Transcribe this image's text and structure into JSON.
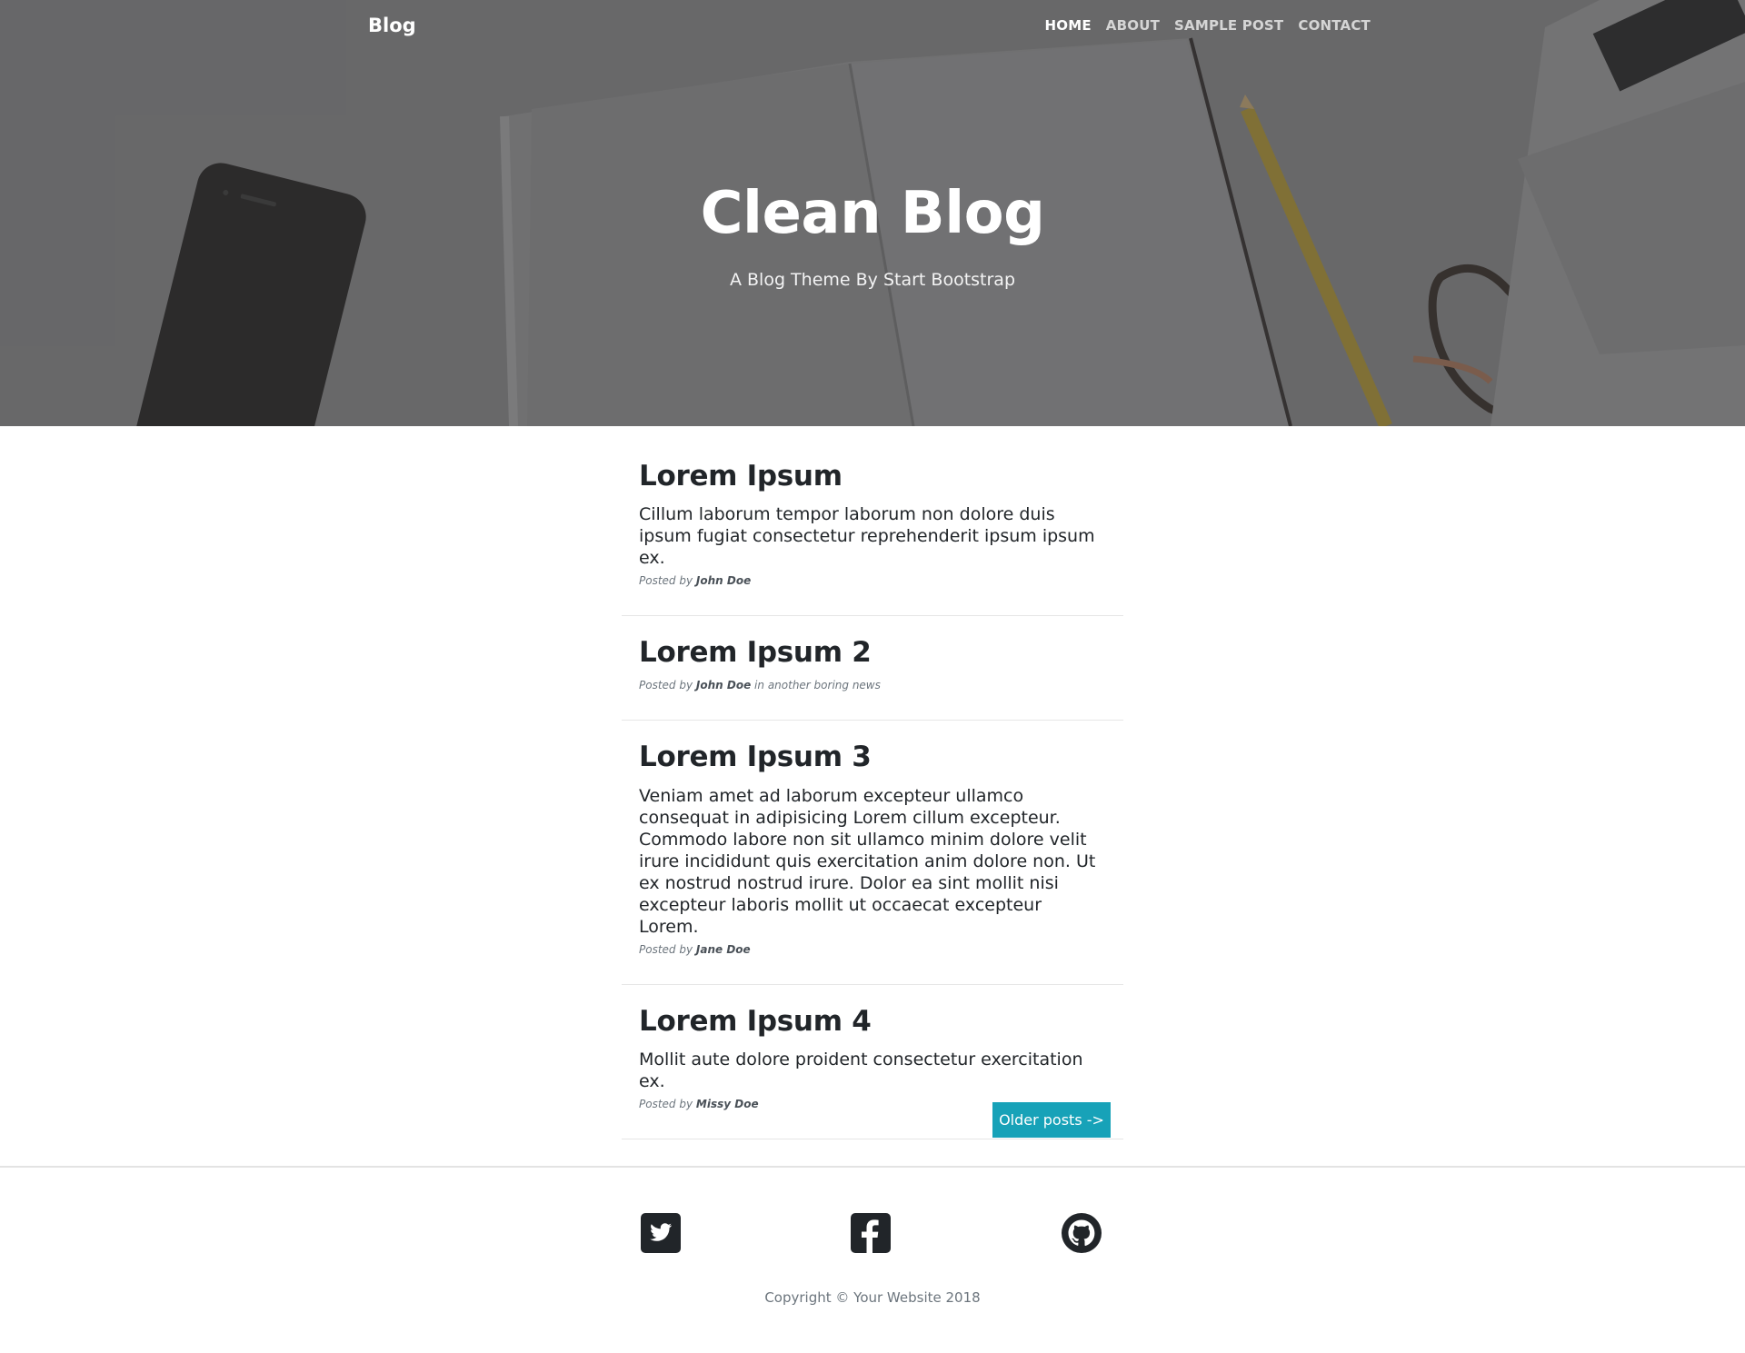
{
  "nav": {
    "brand": "Blog",
    "links": [
      "HOME",
      "ABOUT",
      "SAMPLE POST",
      "CONTACT"
    ],
    "active_index": 0
  },
  "hero": {
    "title": "Clean Blog",
    "subtitle": "A Blog Theme By Start Bootstrap"
  },
  "posts": [
    {
      "title": "Lorem Ipsum",
      "excerpt": "Cillum laborum tempor laborum non dolore duis ipsum fugiat consectetur reprehenderit ipsum ipsum ex.",
      "posted_by": "Posted by",
      "author": "John Doe",
      "category_prefix": "",
      "category": ""
    },
    {
      "title": "Lorem Ipsum 2",
      "excerpt": "",
      "posted_by": "Posted by",
      "author": "John Doe",
      "category_prefix": " in ",
      "category": "another boring news"
    },
    {
      "title": "Lorem Ipsum 3",
      "excerpt": "Veniam amet ad laborum excepteur ullamco consequat in adipisicing Lorem cillum excepteur. Commodo labore non sit ullamco minim dolore velit irure incididunt quis exercitation anim dolore non. Ut ex nostrud nostrud irure. Dolor ea sint mollit nisi excepteur laboris mollit ut occaecat excepteur Lorem.",
      "posted_by": "Posted by",
      "author": "Jane Doe",
      "category_prefix": "",
      "category": ""
    },
    {
      "title": "Lorem Ipsum 4",
      "excerpt": "Mollit aute dolore proident consectetur exercitation ex.",
      "posted_by": "Posted by",
      "author": "Missy Doe",
      "category_prefix": "",
      "category": ""
    }
  ],
  "pager": {
    "older_label": "Older posts ->"
  },
  "footer": {
    "social_icons": [
      "twitter-icon",
      "facebook-icon",
      "github-icon"
    ],
    "copyright": "Copyright © Your Website 2018"
  },
  "colors": {
    "accent": "#17a2b8",
    "text": "#212529",
    "muted": "#6c757d"
  }
}
